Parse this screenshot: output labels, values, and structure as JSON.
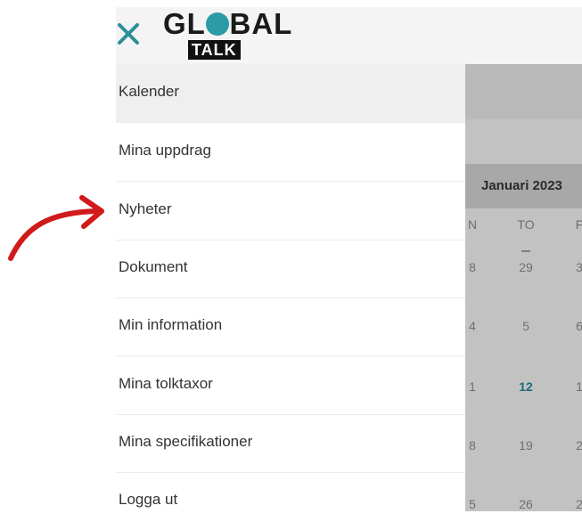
{
  "header": {
    "logo_top": "GLOBAL",
    "logo_bottom": "TALK",
    "accent_color": "#2c9aa7"
  },
  "menu": {
    "items": [
      {
        "label": "Kalender",
        "active": true
      },
      {
        "label": "Mina uppdrag"
      },
      {
        "label": "Nyheter"
      },
      {
        "label": "Dokument"
      },
      {
        "label": "Min information"
      },
      {
        "label": "Mina tolktaxor"
      },
      {
        "label": "Mina specifikationer"
      },
      {
        "label": "Logga ut"
      }
    ]
  },
  "calendar": {
    "month": "Januari 2023",
    "day_headers": [
      "N",
      "TO",
      "F"
    ],
    "rows": [
      [
        "8",
        "29",
        "3"
      ],
      [
        "4",
        "5",
        "6"
      ],
      [
        "1",
        "12",
        "1"
      ],
      [
        "8",
        "19",
        "2"
      ],
      [
        "5",
        "26",
        "2"
      ]
    ],
    "today": "12"
  }
}
